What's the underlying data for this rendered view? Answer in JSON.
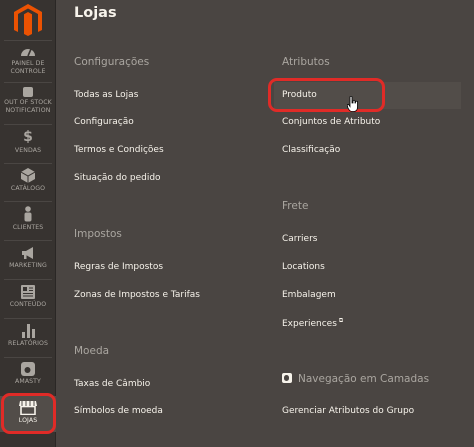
{
  "sidebar": {
    "items": [
      {
        "label_1": "PAINEL DE",
        "label_2": "CONTROLE",
        "icon": "dashboard-icon"
      },
      {
        "label_1": "OUT OF STOCK",
        "label_2": "NOTIFICATION",
        "icon": "notification-icon"
      },
      {
        "label_1": "VENDAS",
        "icon": "dollar-icon"
      },
      {
        "label_1": "CATÁLOGO",
        "icon": "cube-icon"
      },
      {
        "label_1": "CLIENTES",
        "icon": "person-icon"
      },
      {
        "label_1": "MARKETING",
        "icon": "megaphone-icon"
      },
      {
        "label_1": "CONTEÚDO",
        "icon": "content-icon"
      },
      {
        "label_1": "RELATÓRIOS",
        "icon": "bar-chart-icon"
      },
      {
        "label_1": "AMASTY",
        "icon": "amasty-icon"
      },
      {
        "label_1": "LOJAS",
        "icon": "store-icon"
      }
    ]
  },
  "panel": {
    "title": "Lojas",
    "left": {
      "configuracoes": {
        "title": "Configurações",
        "links": [
          "Todas as Lojas",
          "Configuração",
          "Termos e Condições",
          "Situação do pedido"
        ]
      },
      "impostos": {
        "title": "Impostos",
        "links": [
          "Regras de Impostos",
          "Zonas de Impostos e Tarifas"
        ]
      },
      "moeda": {
        "title": "Moeda",
        "links": [
          "Taxas de Câmbio",
          "Símbolos de moeda"
        ]
      }
    },
    "right": {
      "atributos": {
        "title": "Atributos",
        "links": [
          "Produto",
          "Conjuntos de Atributo",
          "Classificação"
        ]
      },
      "frete": {
        "title": "Frete",
        "links": [
          "Carriers",
          "Locations",
          "Embalagem",
          "Experiences"
        ]
      },
      "navegacao": {
        "title": "Navegação em Camadas",
        "links": [
          "Gerenciar Atributos do Grupo"
        ]
      }
    }
  },
  "colors": {
    "sidebar_bg": "#373330",
    "panel_bg": "#4a4542",
    "accent_logo": "#eb5202",
    "highlight_ring": "#e02b27",
    "text_light": "#f7f3eb",
    "text_muted": "#aaa6a0"
  }
}
